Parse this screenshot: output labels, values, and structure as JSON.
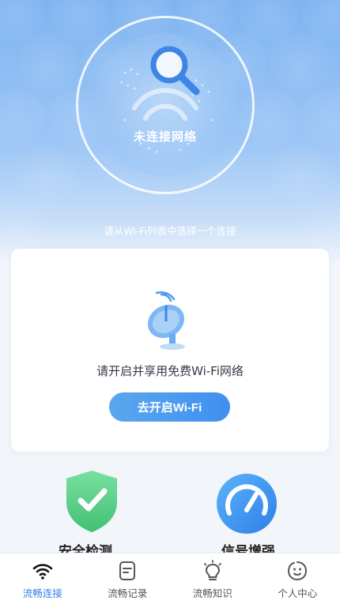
{
  "hero": {
    "status": "未连接网络",
    "hint": "请从Wi-Fi列表中选择一个连接"
  },
  "card": {
    "text": "请开启并享用免费Wi-Fi网络",
    "button": "去开启Wi-Fi"
  },
  "features": [
    {
      "label": "安全检测",
      "icon": "shield-check-icon"
    },
    {
      "label": "信号增强",
      "icon": "speedometer-icon"
    }
  ],
  "tabbar": {
    "items": [
      {
        "label": "流畅连接",
        "icon": "wifi-icon",
        "active": true
      },
      {
        "label": "流畅记录",
        "icon": "record-icon",
        "active": false
      },
      {
        "label": "流畅知识",
        "icon": "lightbulb-icon",
        "active": false
      },
      {
        "label": "个人中心",
        "icon": "profile-icon",
        "active": false
      }
    ]
  },
  "colors": {
    "accent": "#2f7fe6",
    "button": "#4a9af0",
    "shield": "#5fd08a"
  }
}
